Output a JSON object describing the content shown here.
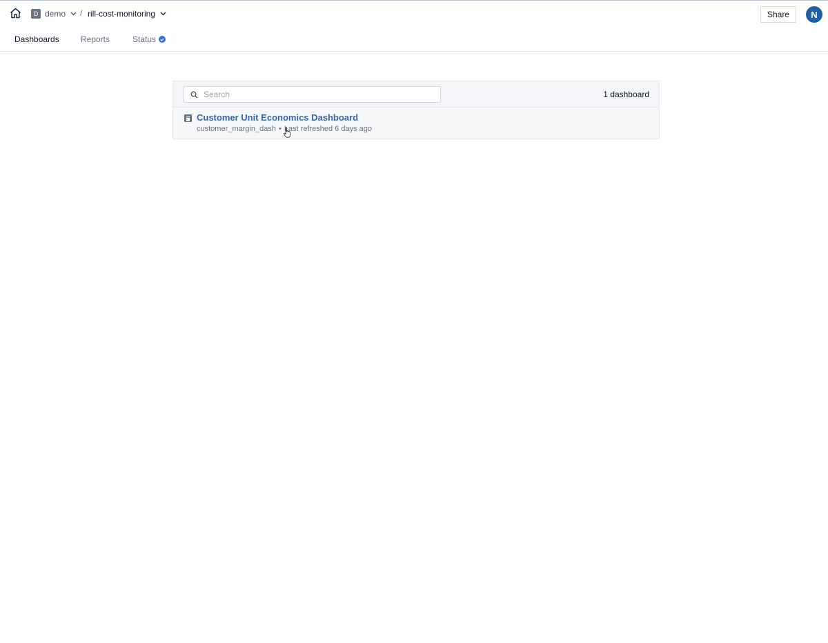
{
  "header": {
    "home_icon": "home-icon",
    "org": {
      "initial": "D",
      "name": "demo"
    },
    "separator": "/",
    "project": {
      "name": "rill-cost-monitoring"
    },
    "share_label": "Share",
    "user_initial": "N"
  },
  "tabs": [
    {
      "label": "Dashboards",
      "active": true
    },
    {
      "label": "Reports",
      "active": false
    },
    {
      "label": "Status",
      "active": false,
      "status_icon": "check-circle-icon"
    }
  ],
  "dashboards": {
    "search": {
      "placeholder": "Search",
      "value": ""
    },
    "count_label": "1 dashboard",
    "items": [
      {
        "title": "Customer Unit Economics Dashboard",
        "name": "customer_margin_dash",
        "bullet": "•",
        "refreshed": "Last refreshed 6 days ago"
      }
    ]
  },
  "colors": {
    "link": "#3565b7",
    "avatar": "#1e5fa8",
    "status": "#2f6fdb"
  }
}
